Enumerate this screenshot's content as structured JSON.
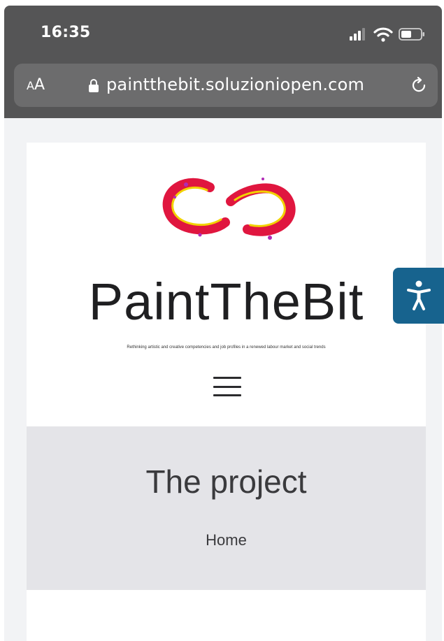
{
  "status_bar": {
    "time": "16:35",
    "icons": [
      "signal-icon",
      "wifi-icon",
      "battery-icon"
    ]
  },
  "browser": {
    "text_size_small": "A",
    "text_size_large": "A",
    "url": "paintthebit.soluzioniopen.com",
    "icons": [
      "lock-icon",
      "reload-icon"
    ]
  },
  "site": {
    "title": "PaintTheBit",
    "tagline": "Rethinking artistic and creative competencies and job profiles in a renewed labour market and social trends",
    "logo_colors": [
      "#e0163f",
      "#f2d200",
      "#b02ab6"
    ]
  },
  "page": {
    "title": "The project",
    "breadcrumb": "Home"
  },
  "accessibility": {
    "icon": "accessibility-icon",
    "color": "#17638e"
  }
}
